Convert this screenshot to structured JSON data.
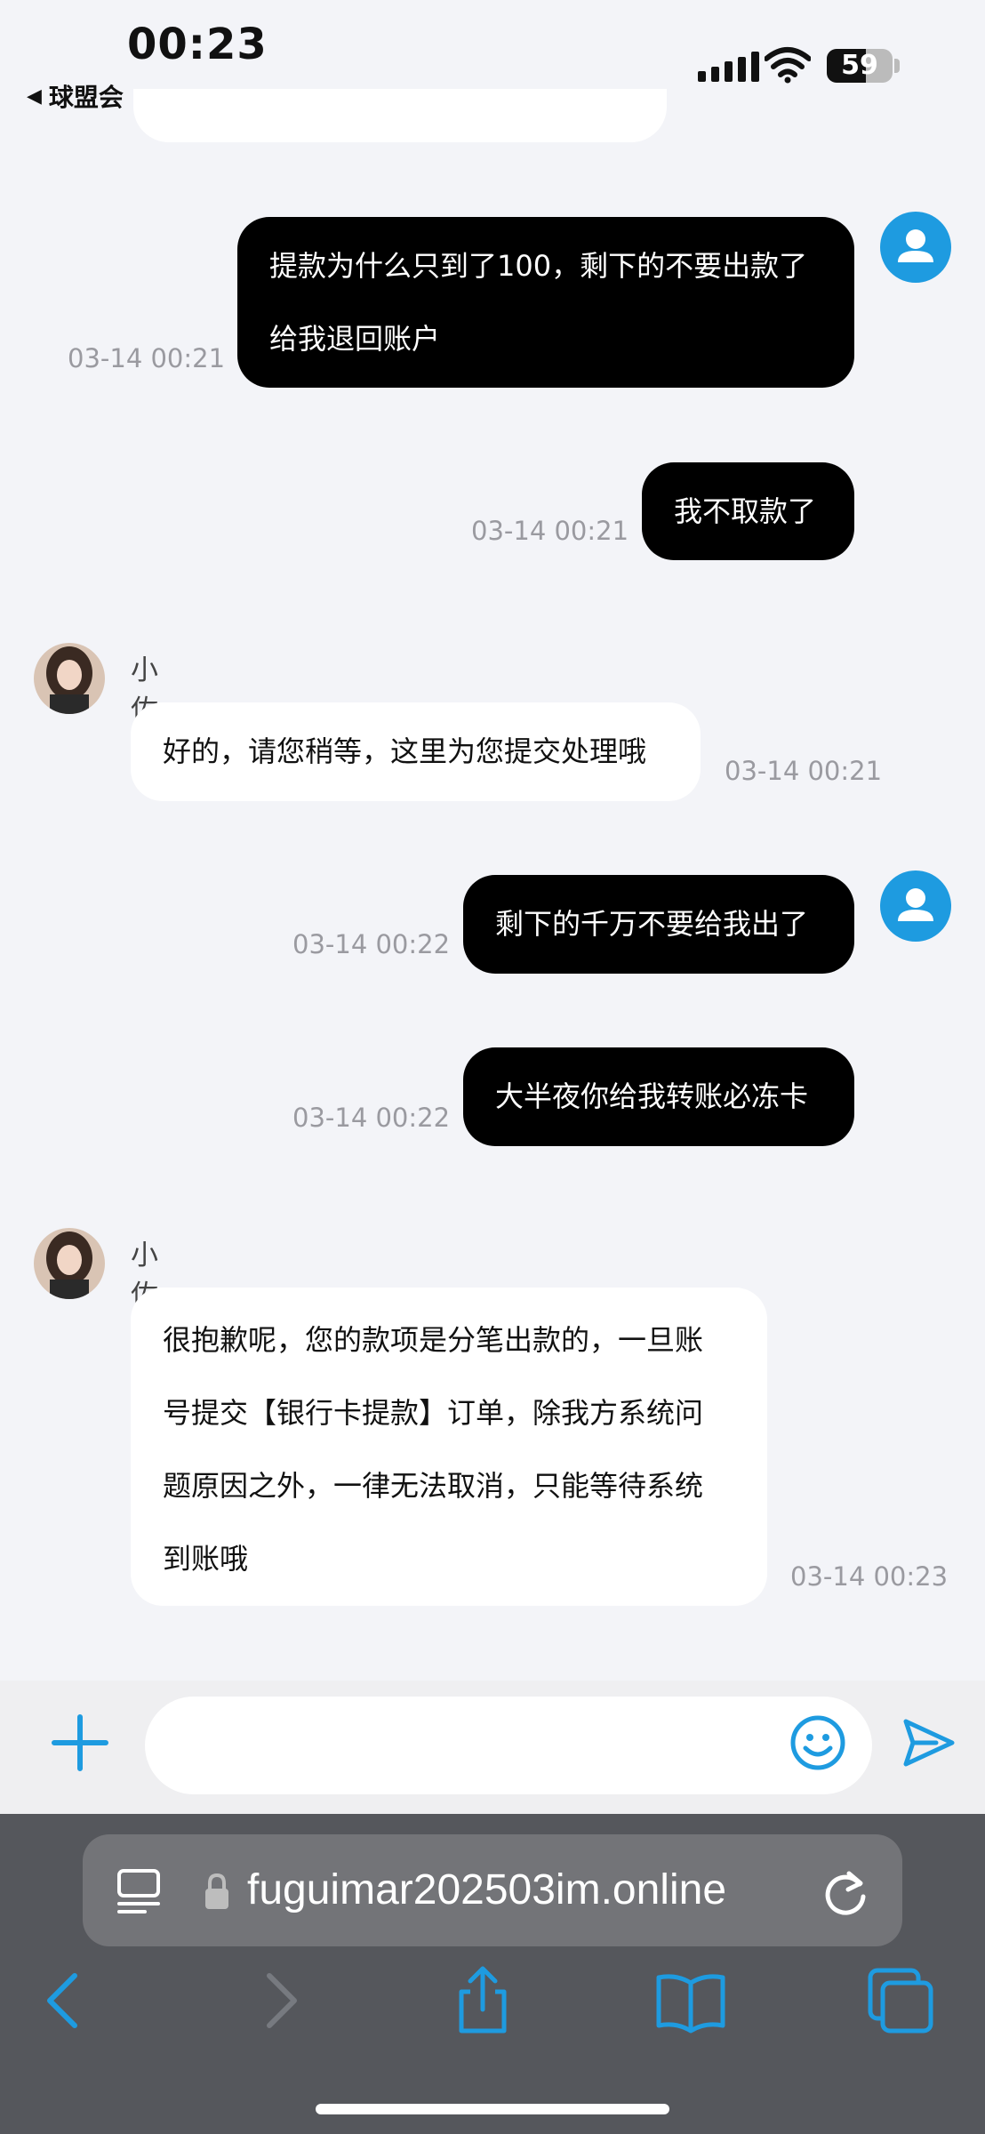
{
  "status_bar": {
    "time": "00:23",
    "back_app": "球盟会",
    "battery": "59",
    "battery_level": 0.59
  },
  "messages": [
    {
      "side": "out",
      "lines": [
        "提款为什么只到了100，剩下的不要出款了",
        "给我退回账户"
      ],
      "time": "03-14 00:21"
    },
    {
      "side": "out",
      "lines": [
        "我不取款了"
      ],
      "time": "03-14 00:21"
    },
    {
      "side": "in",
      "sender": "小佐",
      "lines": [
        "好的，请您稍等，这里为您提交处理哦"
      ],
      "time": "03-14 00:21"
    },
    {
      "side": "out",
      "lines": [
        "剩下的千万不要给我出了"
      ],
      "time": "03-14 00:22"
    },
    {
      "side": "out",
      "lines": [
        "大半夜你给我转账必冻卡"
      ],
      "time": "03-14 00:22"
    },
    {
      "side": "in",
      "sender": "小佐",
      "lines": [
        "很抱歉呢，您的款项是分笔出款的，一旦账",
        "号提交【银行卡提款】订单，除我方系统问",
        "题原因之外，一律无法取消，只能等待系统",
        "到账哦"
      ],
      "time": "03-14 00:23"
    }
  ],
  "input": {
    "value": "",
    "placeholder": ""
  },
  "browser": {
    "url": "fuguimar202503im.online"
  },
  "colors": {
    "accent": "#1e9be0",
    "out_bubble": "#000000",
    "in_bubble": "#ffffff",
    "page_bg": "#f3f4f8"
  },
  "icons": [
    "plus-icon",
    "emoji-icon",
    "send-icon",
    "reader-icon",
    "lock-icon",
    "reload-icon",
    "back-icon",
    "forward-icon",
    "share-icon",
    "bookmarks-icon",
    "tabs-icon"
  ]
}
